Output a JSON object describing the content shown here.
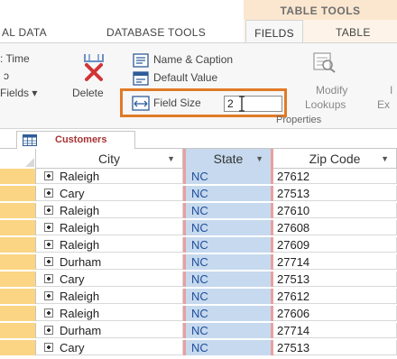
{
  "ribbon": {
    "context_header": "TABLE TOOLS",
    "tabs": [
      {
        "label": "AL DATA"
      },
      {
        "label": "DATABASE TOOLS"
      },
      {
        "label": "FIELDS"
      },
      {
        "label": "TABLE"
      }
    ],
    "left_group": {
      "line1": ": Time",
      "line2": "ɔ",
      "line3": "Fields ▾"
    },
    "delete_label": "Delete",
    "commands": {
      "name_caption": "Name & Caption",
      "default_value": "Default Value",
      "field_size_label": "Field Size",
      "field_size_value": "2"
    },
    "modify_lookups_line1": "Modify",
    "modify_lookups_line2": "Lookups",
    "expr_partial": "Ex",
    "cut_edge": "I",
    "properties_group_label": "Properties"
  },
  "document_tab": {
    "label": "Customers"
  },
  "datasheet": {
    "columns": [
      {
        "label": "City"
      },
      {
        "label": "State"
      },
      {
        "label": "Zip Code"
      }
    ],
    "rows": [
      {
        "city": "Raleigh",
        "state": "NC",
        "zip": "27612"
      },
      {
        "city": "Cary",
        "state": "NC",
        "zip": "27513"
      },
      {
        "city": "Raleigh",
        "state": "NC",
        "zip": "27610"
      },
      {
        "city": "Raleigh",
        "state": "NC",
        "zip": "27608"
      },
      {
        "city": "Raleigh",
        "state": "NC",
        "zip": "27609"
      },
      {
        "city": "Durham",
        "state": "NC",
        "zip": "27714"
      },
      {
        "city": "Cary",
        "state": "NC",
        "zip": "27513"
      },
      {
        "city": "Raleigh",
        "state": "NC",
        "zip": "27612"
      },
      {
        "city": "Raleigh",
        "state": "NC",
        "zip": "27606"
      },
      {
        "city": "Durham",
        "state": "NC",
        "zip": "27714"
      },
      {
        "city": "Cary",
        "state": "NC",
        "zip": "27513"
      }
    ]
  },
  "colors": {
    "accent_orange": "#e07b28",
    "context_tab_bg": "#fbe7d0",
    "selected_column": "#c6d9ee",
    "record_selector": "#fbd583",
    "tab_label_red": "#a83232"
  }
}
